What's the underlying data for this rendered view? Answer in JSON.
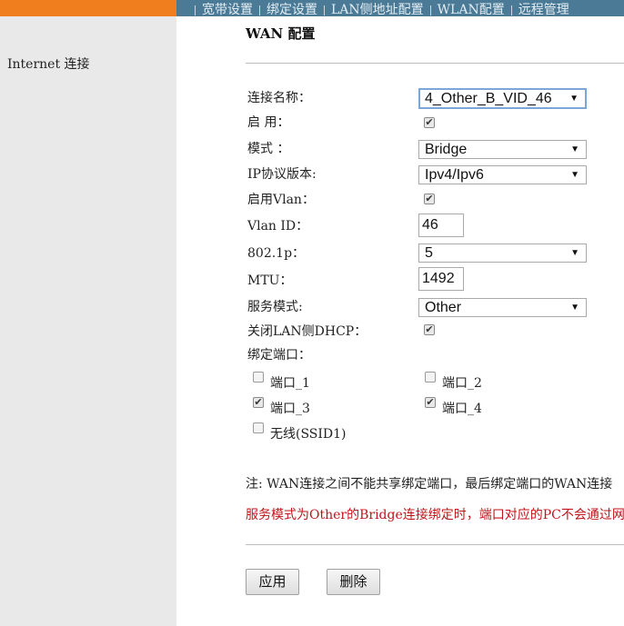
{
  "top_nav": {
    "items": [
      "宽带设置",
      "绑定设置",
      "LAN侧地址配置",
      "WLAN配置",
      "远程管理"
    ]
  },
  "sidebar": {
    "items": [
      {
        "label": "Internet 连接"
      }
    ]
  },
  "page": {
    "title": "WAN 配置"
  },
  "form": {
    "connection_name": {
      "label": "连接名称：",
      "value": "4_Other_B_VID_46"
    },
    "enable": {
      "label": "启 用：",
      "checked": true
    },
    "mode": {
      "label": "模式 ：",
      "value": "Bridge"
    },
    "ip_version": {
      "label": "IP协议版本:",
      "value": "Ipv4/Ipv6"
    },
    "enable_vlan": {
      "label": "启用Vlan：",
      "checked": true
    },
    "vlan_id": {
      "label": "Vlan ID：",
      "value": "46"
    },
    "priority_8021p": {
      "label": "802.1p：",
      "value": "5"
    },
    "mtu": {
      "label": "MTU：",
      "value": "1492"
    },
    "service_mode": {
      "label": "服务模式:",
      "value": "Other"
    },
    "disable_lan_dhcp": {
      "label": "关闭LAN侧DHCP：",
      "checked": true
    },
    "bind_ports_label": "绑定端口：",
    "ports": [
      {
        "label": "端口_1",
        "checked": false
      },
      {
        "label": "端口_2",
        "checked": false
      },
      {
        "label": "端口_3",
        "checked": true
      },
      {
        "label": "端口_4",
        "checked": true
      },
      {
        "label": "无线(SSID1)",
        "checked": false
      }
    ]
  },
  "notes": {
    "note1": "注: WAN连接之间不能共享绑定端口，最后绑定端口的WAN连接",
    "note2": "服务模式为Other的Bridge连接绑定时，端口对应的PC不会通过网"
  },
  "buttons": {
    "apply": "应用",
    "delete": "删除"
  },
  "colors": {
    "top_orange": "#f07d1e",
    "nav_bar": "#4a7a96",
    "sidebar_bg": "#e9e9e9",
    "note_red": "#c0151a"
  }
}
